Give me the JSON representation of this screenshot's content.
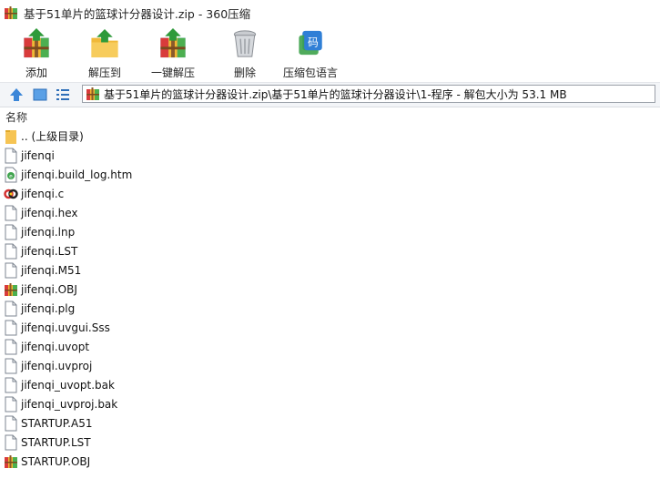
{
  "window": {
    "title": "基于51单片的篮球计分器设计.zip - 360压缩",
    "app_icon": "archive-icon"
  },
  "toolbar": {
    "items": [
      {
        "label": "添加",
        "icon": "add-archive-icon"
      },
      {
        "label": "解压到",
        "icon": "extract-to-icon"
      },
      {
        "label": "一键解压",
        "icon": "one-click-extract-icon"
      },
      {
        "label": "删除",
        "icon": "trash-icon"
      },
      {
        "label": "压缩包语言",
        "icon": "archive-language-icon",
        "icon_text": "码"
      }
    ]
  },
  "navigation": {
    "up_icon": "up-arrow-icon",
    "view_icon": "view-large-icon",
    "list_icon": "view-list-icon",
    "address": "基于51单片的篮球计分器设计.zip\\基于51单片的篮球计分器设计\\1-程序 - 解包大小为 53.1 MB"
  },
  "file_list": {
    "column_name": "名称",
    "items": [
      {
        "name": ".. (上级目录)",
        "icon": "folder-icon"
      },
      {
        "name": "jifenqi",
        "icon": "file-icon"
      },
      {
        "name": "jifenqi.build_log.htm",
        "icon": "html-file-icon"
      },
      {
        "name": "jifenqi.c",
        "icon": "c-source-icon"
      },
      {
        "name": "jifenqi.hex",
        "icon": "file-icon"
      },
      {
        "name": "jifenqi.lnp",
        "icon": "file-icon"
      },
      {
        "name": "jifenqi.LST",
        "icon": "file-icon"
      },
      {
        "name": "jifenqi.M51",
        "icon": "file-icon"
      },
      {
        "name": "jifenqi.OBJ",
        "icon": "archive-file-icon"
      },
      {
        "name": "jifenqi.plg",
        "icon": "file-icon"
      },
      {
        "name": "jifenqi.uvgui.Sss",
        "icon": "file-icon"
      },
      {
        "name": "jifenqi.uvopt",
        "icon": "file-icon"
      },
      {
        "name": "jifenqi.uvproj",
        "icon": "file-icon"
      },
      {
        "name": "jifenqi_uvopt.bak",
        "icon": "file-icon"
      },
      {
        "name": "jifenqi_uvproj.bak",
        "icon": "file-icon"
      },
      {
        "name": "STARTUP.A51",
        "icon": "file-icon"
      },
      {
        "name": "STARTUP.LST",
        "icon": "file-icon"
      },
      {
        "name": "STARTUP.OBJ",
        "icon": "archive-file-icon"
      }
    ]
  }
}
